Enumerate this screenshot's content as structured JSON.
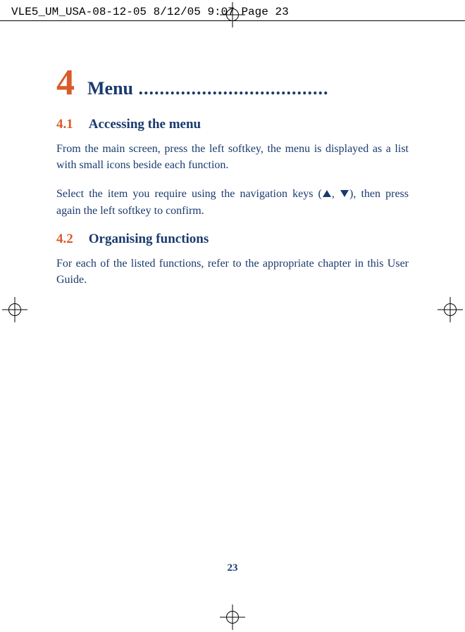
{
  "header": {
    "text": "VLE5_UM_USA-08-12-05  8/12/05  9:07  Page 23"
  },
  "chapter": {
    "number": "4",
    "title": "Menu",
    "dots": " ...................................."
  },
  "sections": [
    {
      "number": "4.1",
      "title": "Accessing the menu",
      "paragraphs": [
        "From the main screen, press the left softkey, the menu is displayed as a list with small icons beside each function."
      ],
      "nav_paragraph": {
        "before": "Select the item you require using the navigation keys (",
        "separator": ", ",
        "after": "), then press again the left softkey to confirm."
      }
    },
    {
      "number": "4.2",
      "title": "Organising functions",
      "paragraphs": [
        "For each of the listed functions, refer to the appropriate chapter in this User Guide."
      ]
    }
  ],
  "page_number": "23"
}
